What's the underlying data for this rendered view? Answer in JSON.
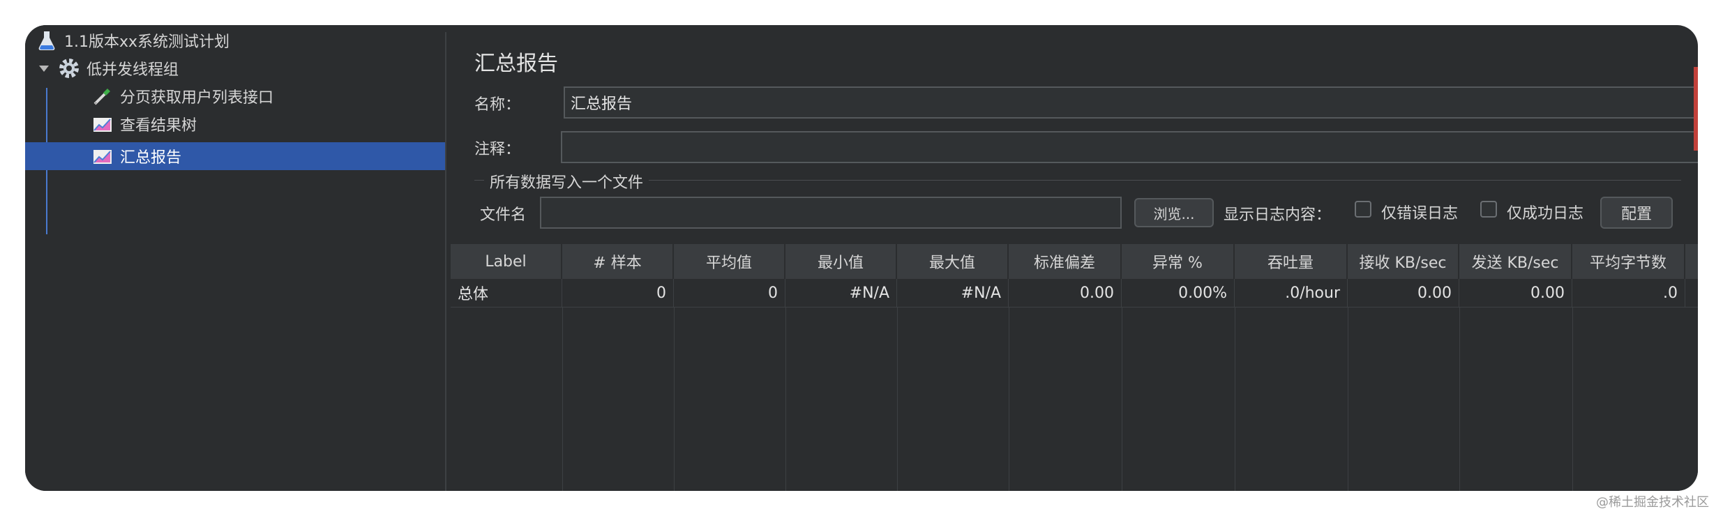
{
  "tree": {
    "items": [
      {
        "label": "1.1版本xx系统测试计划",
        "icon": "flask-icon"
      },
      {
        "label": "低并发线程组",
        "icon": "gear-icon"
      },
      {
        "label": "分页获取用户列表接口",
        "icon": "pipette-icon"
      },
      {
        "label": "查看结果树",
        "icon": "chart-icon"
      },
      {
        "label": "汇总报告",
        "icon": "chart-icon"
      }
    ],
    "selected_index": 4
  },
  "panel": {
    "title": "汇总报告",
    "name_label": "名称：",
    "name_value": "汇总报告",
    "comment_label": "注释：",
    "comment_value": "",
    "group_title": "所有数据写入一个文件",
    "file_label": "文件名",
    "file_value": "",
    "browse_label": "浏览...",
    "log_label": "显示日志内容：",
    "errors_only_label": "仅错误日志",
    "success_only_label": "仅成功日志",
    "config_label": "配置"
  },
  "table": {
    "headers": [
      "Label",
      "# 样本",
      "平均值",
      "最小值",
      "最大值",
      "标准偏差",
      "异常 %",
      "吞吐量",
      "接收 KB/sec",
      "发送 KB/sec",
      "平均字节数"
    ],
    "rows": [
      [
        "总体",
        "0",
        "0",
        "#N/A",
        "#N/A",
        "0.00",
        "0.00%",
        ".0/hour",
        "0.00",
        "0.00",
        ".0"
      ]
    ]
  },
  "watermark": "@稀土掘金技术社区",
  "colors": {
    "background": "#2b2d2f",
    "selection": "#2f58a8",
    "header_bg": "#3a3d40",
    "text": "#d6d6d6"
  }
}
